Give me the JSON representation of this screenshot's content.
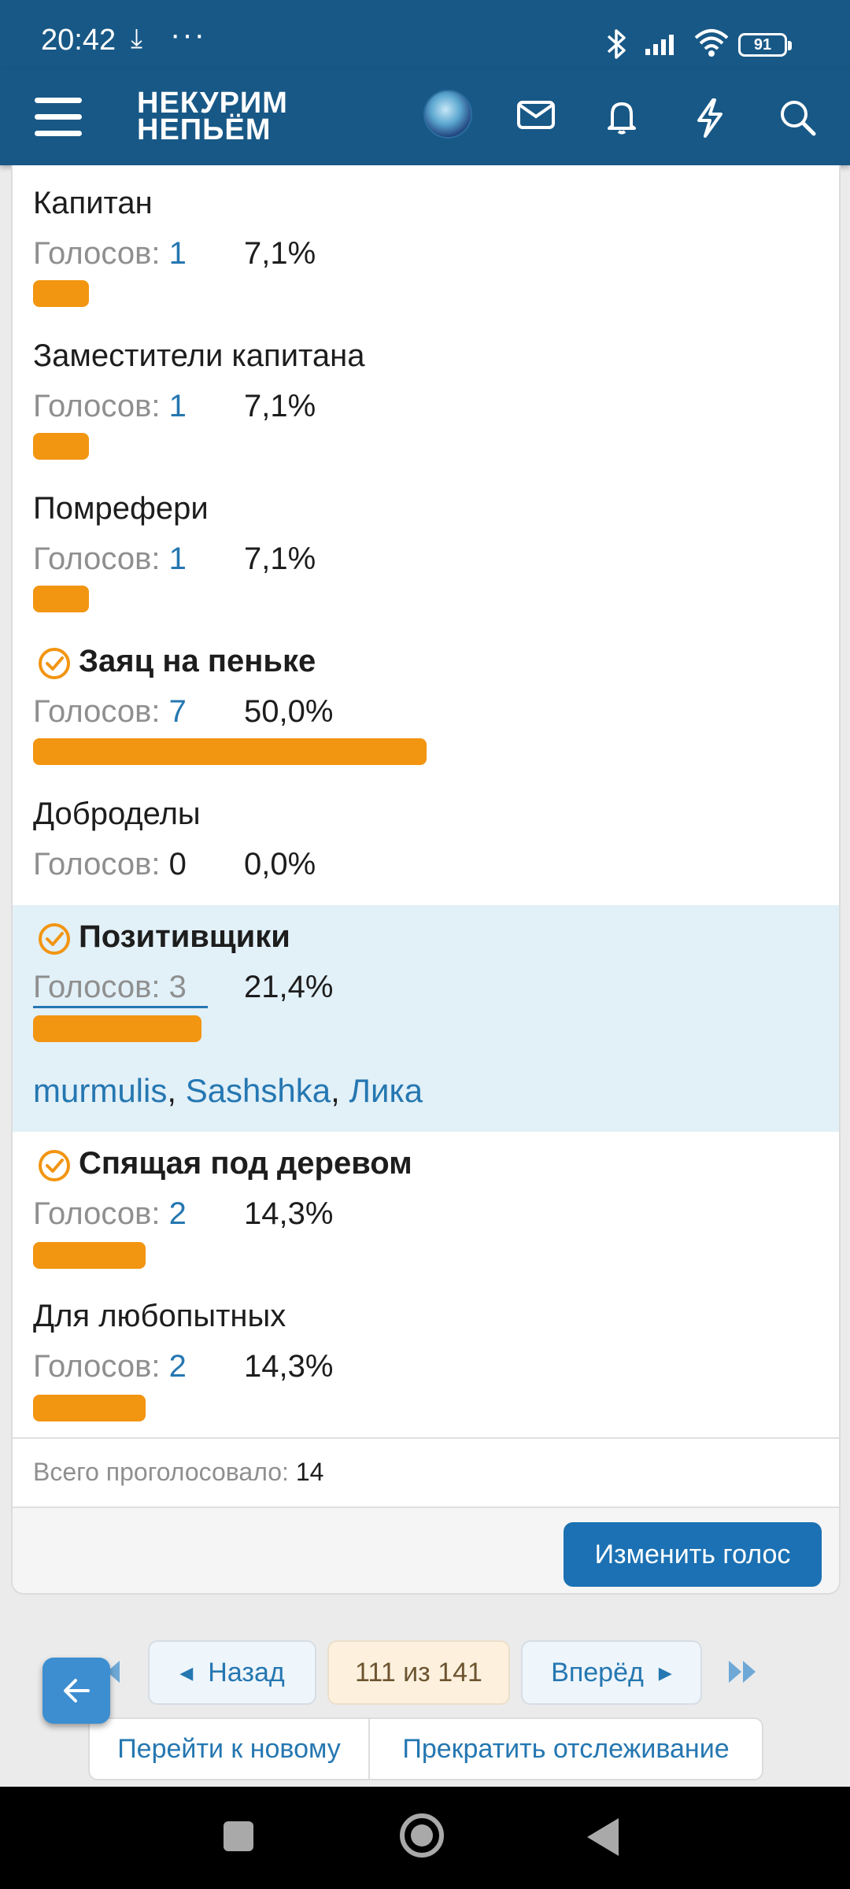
{
  "status_bar": {
    "time": "20:42",
    "battery": "91"
  },
  "header": {
    "logo_line1": "НЕКУРИМ",
    "logo_line2": "НЕПЬЁМ"
  },
  "poll": {
    "votes_label": "Голосов:",
    "options": [
      {
        "title": "Капитан",
        "count": "1",
        "percent": "7,1%",
        "share": 7.1,
        "selected": false
      },
      {
        "title": "Заместители капитана",
        "count": "1",
        "percent": "7,1%",
        "share": 7.1,
        "selected": false
      },
      {
        "title": "Помрефери",
        "count": "1",
        "percent": "7,1%",
        "share": 7.1,
        "selected": false
      },
      {
        "title": "Заяц на пеньке",
        "count": "7",
        "percent": "50,0%",
        "share": 50.0,
        "selected": true
      },
      {
        "title": "Доброделы",
        "count": "0",
        "percent": "0,0%",
        "share": 0.0,
        "selected": false
      },
      {
        "title": "Позитивщики",
        "count": "3",
        "percent": "21,4%",
        "share": 21.4,
        "selected": true,
        "voters": [
          "murmulis",
          "Sashshka",
          "Лика"
        ]
      },
      {
        "title": "Спящая под деревом",
        "count": "2",
        "percent": "14,3%",
        "share": 14.3,
        "selected": true
      },
      {
        "title": "Для любопытных",
        "count": "2",
        "percent": "14,3%",
        "share": 14.3,
        "selected": false
      }
    ],
    "total_label": "Всего проголосовало:",
    "total_value": "14",
    "change_vote": "Изменить голос"
  },
  "pagination": {
    "prev": "Назад",
    "current": "111 из 141",
    "next": "Вперёд",
    "goto_new": "Перейти к новому",
    "unwatch": "Прекратить отслеживание"
  },
  "colors": {
    "brand": "#185886",
    "bar": "#f29511",
    "link": "#2577b1",
    "highlight": "#e2f0f8"
  }
}
